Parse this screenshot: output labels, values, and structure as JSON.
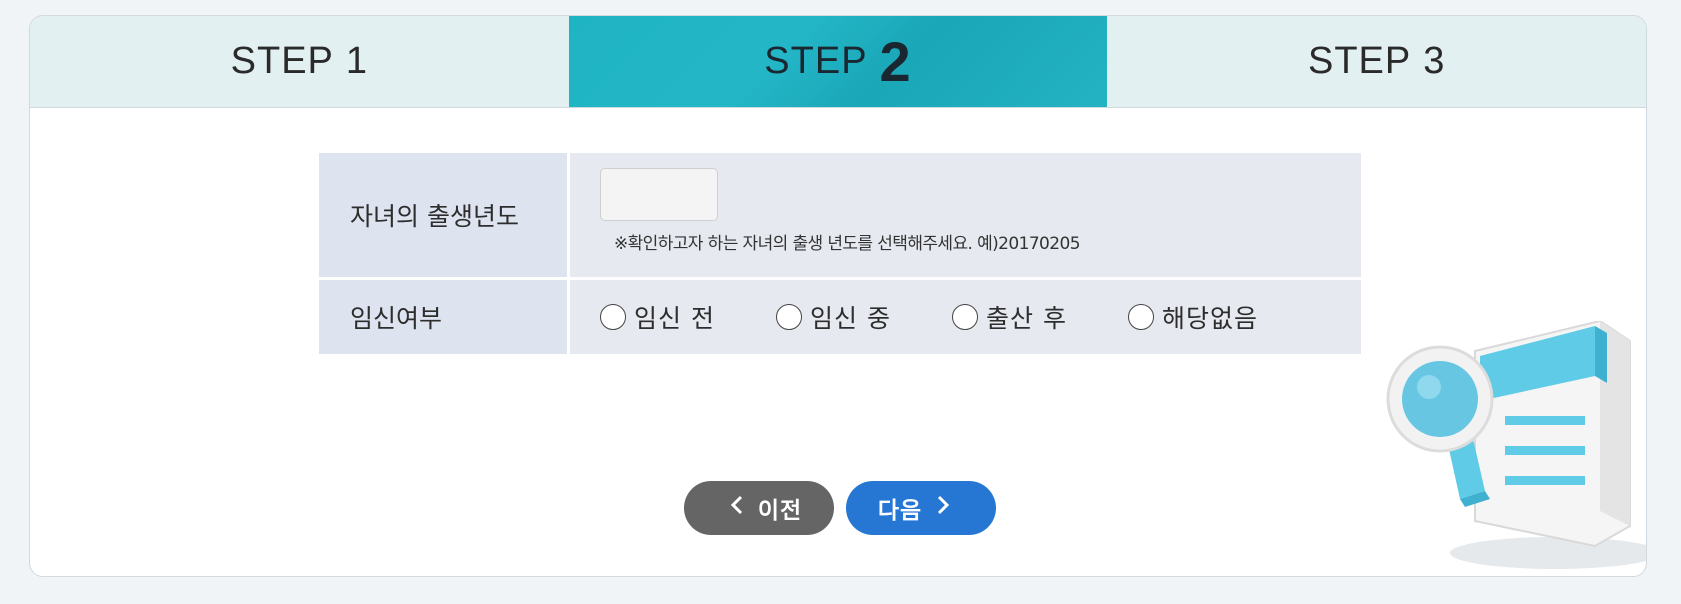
{
  "steps": [
    {
      "label": "STEP",
      "num": "1"
    },
    {
      "label": "STEP",
      "num": "2"
    },
    {
      "label": "STEP",
      "num": "3"
    }
  ],
  "form": {
    "birth_year_label": "자녀의 출생년도",
    "birth_year_value": "",
    "birth_year_hint": "※확인하고자 하는 자녀의 출생 년도를 선택해주세요. 예)20170205",
    "pregnancy_label": "임신여부",
    "pregnancy_options": [
      "임신 전",
      "임신 중",
      "출산 후",
      "해당없음"
    ]
  },
  "buttons": {
    "prev_label": "이전",
    "next_label": "다음"
  },
  "colors": {
    "active_step": "#1fb4c4",
    "next_button": "#2677d4",
    "prev_button": "#656565"
  }
}
